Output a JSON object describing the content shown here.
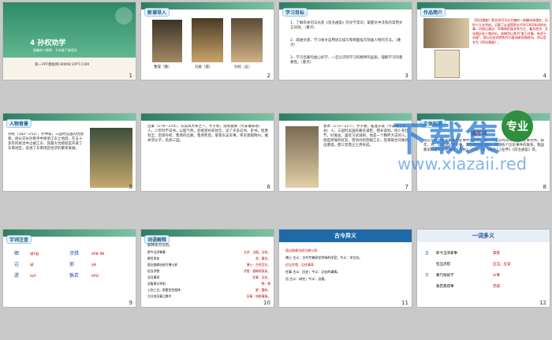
{
  "s1": {
    "title": "4 孙权劝学",
    "sub": "部编本人教版 · 七年级下册语文",
    "footer": "第一PPT模板网-WWW.1PPT.COM",
    "num": "1"
  },
  "s2": {
    "tag": "新课导入",
    "names": [
      "曹操（魏）",
      "刘备（蜀）",
      "孙权（吴）"
    ],
    "num": "2"
  },
  "s3": {
    "tag": "学习目标",
    "lines": [
      "1．了解有关司马光及《资治通鉴》的文学常识；掌握文中涉及的常用文言词语。（重点）",
      "2．疏通文意，学习本文运用语言描写和侧面描写刻画人物的方法。（难点）",
      "3．学习吕蒙的虚心好学、一旦认识到学习的精神的品质，理解学习的重要性。（重点）"
    ],
    "num": "3"
  },
  "s4": {
    "tag": "作品简介",
    "text": "《资治通鉴》是北宋司马光主编的一部编年体通史，历时十九年完成。记载了从战国到五代共1362年间的史事，内容以政治、军事和民族关系为主，兼及经济、文化和历史人物评价。宋神宗以其书\"鉴于往事，有资于治道\"，即以历史的得失作为鉴诫来加强统治，所以定名为《资治通鉴》。",
    "num": "4"
  },
  "s5": {
    "tag": "人物背景",
    "text": "孙权（182—252），字仲谋，三国时吴国的创建者。他从兄长孙策手中继承江东之地后，在五十多年的统治中占据江东，其最大功绩就是开发了东南地区，促进了东南地区经济的繁荣发展。",
    "num": "5"
  },
  "s6": {
    "text": "吕蒙（178—219），东吴四大将之一，字子明，汝南富陂（今安徽阜南）人。少年时不读书，以胆气称，后接受孙权劝告，读了许多兵书、史书，智勇双全。后受孙权、鲁肃的信赖，鲁肃死后，掌管东吴军事，率军袭取荆州，擒关羽父子，名扬三国。",
    "num": "6"
  },
  "s7": {
    "text": "鲁肃（172—217），字子敬，临淮东城（今安徽定远县）人。三国时吴国的著名谋臣，擅长谋划，他少有壮节，好施舍，喜欢习武骑射，他是一个胸怀大志的人。他是周瑜的好友，曾劝孙权割据江东，后来联合刘备抗击曹操，使三足鼎立之势形成。",
    "num": "7"
  },
  "s8": {
    "tag": "文体知识",
    "heading": "编年体",
    "text": "指以年代为线索编排历史事件的体例。编年体是以时间为经，以史事为纬，按年、月、日顺序记述史事，比较容易反映同一时期各个历史事件的联系。我国最早的编年体史书是《春秋》，代表作有《春秋》《左传》《资治通鉴》等。",
    "num": "8"
  },
  "watermark": {
    "big": "下载集",
    "badge": "专业",
    "url": "www.xiazaii.red"
  },
  "s9": {
    "tag": "字词注音",
    "rows": [
      [
        "卿",
        "qīng",
        "涉猎",
        "shè liè"
      ],
      [
        "岂",
        "qǐ",
        "邪",
        "yé"
      ],
      [
        "遂",
        "suì",
        "孰若",
        "shú"
      ]
    ],
    "num": "9"
  },
  "s10": {
    "tag": "词语解释",
    "heading": "解释加点词语。",
    "lines": [
      "即今当涂掌事",
      "卿言多务",
      "孤常读书",
      "但当涉猎",
      "见往事耳",
      "孤岂欲卿治经为博士邪",
      "及鲁肃过寻阳",
      "士别三日，即更刮目相待",
      "大兄何见事之晚乎"
    ],
    "answers": [
      "当涂：当道，当权。",
      "务：事务。",
      "博士：古时官名。",
      "涉猎：粗略地阅读。",
      "往事：历史。",
      "更：重新。",
      "刮目：擦擦眼睛。",
      "见事：知晓事情。",
      "晚：晚"
    ],
    "num": "10"
  },
  "s11": {
    "heading": "古今异义",
    "lines": [
      "孤岂欲卿治经为博士邪",
      "博士  古义：古代专掌经学传授的学官；今义：学位名。",
      "但当涉猎，见往事耳",
      "往事  古义：历史；今义：过去的事情。",
      "治  古义：研究；今义：治理。"
    ],
    "num": "11"
  },
  "s12": {
    "heading": "一词多义",
    "rows": [
      [
        "当",
        "即今当涂掌事",
        "掌管"
      ],
      [
        "",
        "但当涉猎",
        "应当；应该"
      ],
      [
        "见",
        "蒙乃始就学",
        "从事"
      ],
      [
        "",
        "孰若孤得事",
        "完成"
      ]
    ],
    "num": "12"
  }
}
